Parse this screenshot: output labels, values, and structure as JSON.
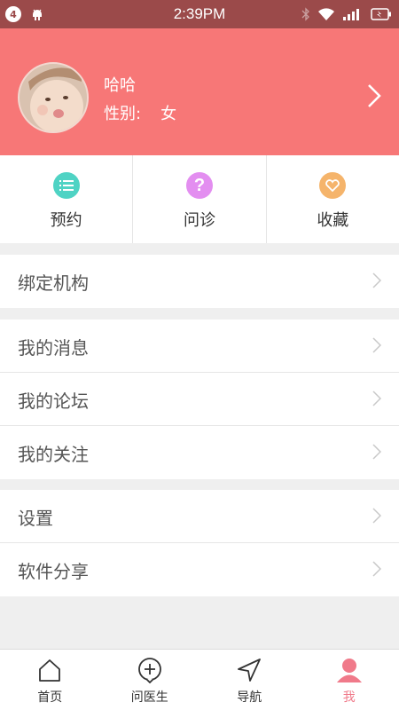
{
  "status_bar": {
    "time": "2:39PM",
    "notification_count": "4"
  },
  "profile": {
    "name": "哈哈",
    "gender_label": "性别:",
    "gender_value": "女"
  },
  "quick_actions": [
    {
      "label": "预约",
      "icon": "list-icon",
      "color": "#4fd3c4"
    },
    {
      "label": "问诊",
      "icon": "question-icon",
      "color": "#e38ef0"
    },
    {
      "label": "收藏",
      "icon": "heart-icon",
      "color": "#f5b46b"
    }
  ],
  "menu": {
    "group1": [
      {
        "label": "绑定机构"
      }
    ],
    "group2": [
      {
        "label": "我的消息"
      },
      {
        "label": "我的论坛"
      },
      {
        "label": "我的关注"
      }
    ],
    "group3": [
      {
        "label": "设置"
      },
      {
        "label": "软件分享"
      }
    ]
  },
  "tabs": [
    {
      "label": "首页",
      "icon": "home-icon",
      "active": false
    },
    {
      "label": "问医生",
      "icon": "add-circle-icon",
      "active": false
    },
    {
      "label": "导航",
      "icon": "navigation-icon",
      "active": false
    },
    {
      "label": "我",
      "icon": "user-icon",
      "active": true
    }
  ],
  "colors": {
    "header": "#f77777",
    "status_bar": "#9b4a4a",
    "active_tab": "#f07a8a"
  }
}
